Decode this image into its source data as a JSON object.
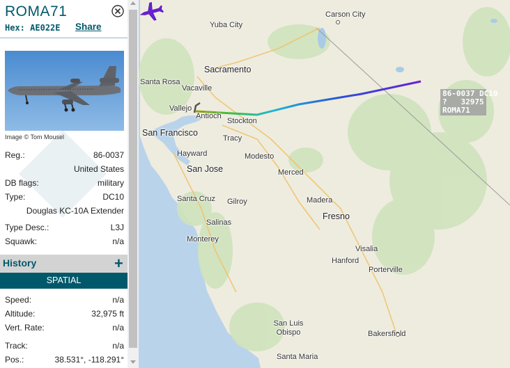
{
  "aircraft": {
    "callsign": "ROMA71",
    "hex_label": "Hex:",
    "hex": "AE022E",
    "share_label": "Share"
  },
  "photo": {
    "credit": "Image © Tom Mousel"
  },
  "details": {
    "reg_label": "Reg.:",
    "reg": "86-0037",
    "country": "United States",
    "dbflags_label": "DB flags:",
    "dbflags": "military",
    "type_label": "Type:",
    "type": "DC10",
    "type_name": "Douglas KC-10A Extender",
    "typedesc_label": "Type Desc.:",
    "typedesc": "L3J",
    "squawk_label": "Squawk:",
    "squawk": "n/a"
  },
  "history": {
    "title": "History",
    "add_symbol": "+"
  },
  "spatial": {
    "header": "SPATIAL",
    "speed_label": "Speed:",
    "speed": "n/a",
    "altitude_label": "Altitude:",
    "altitude": "32,975 ft",
    "vrate_label": "Vert. Rate:",
    "vrate": "n/a",
    "track_label": "Track:",
    "track": "n/a",
    "pos_label": "Pos.:",
    "pos": "38.531°, -118.291°"
  },
  "map_label": {
    "line1": "86-0037 DC10",
    "line2": "?   32975",
    "line3": "ROMA71"
  },
  "cities": [
    "Carson City",
    "Yuba City",
    "Sacramento",
    "Santa Rosa",
    "Vacaville",
    "Vallejo",
    "Antioch",
    "Stockton",
    "San Francisco",
    "Tracy",
    "Hayward",
    "San Jose",
    "Modesto",
    "Merced",
    "Santa Cruz",
    "Gilroy",
    "Madera",
    "Salinas",
    "Fresno",
    "Monterey",
    "Visalia",
    "Hanford",
    "Porterville",
    "San Luis Obispo",
    "Bakersfield",
    "Santa Maria"
  ],
  "colors": {
    "accent": "#00596b",
    "ocean": "#b9d3ea",
    "land": "#f1efe6"
  }
}
